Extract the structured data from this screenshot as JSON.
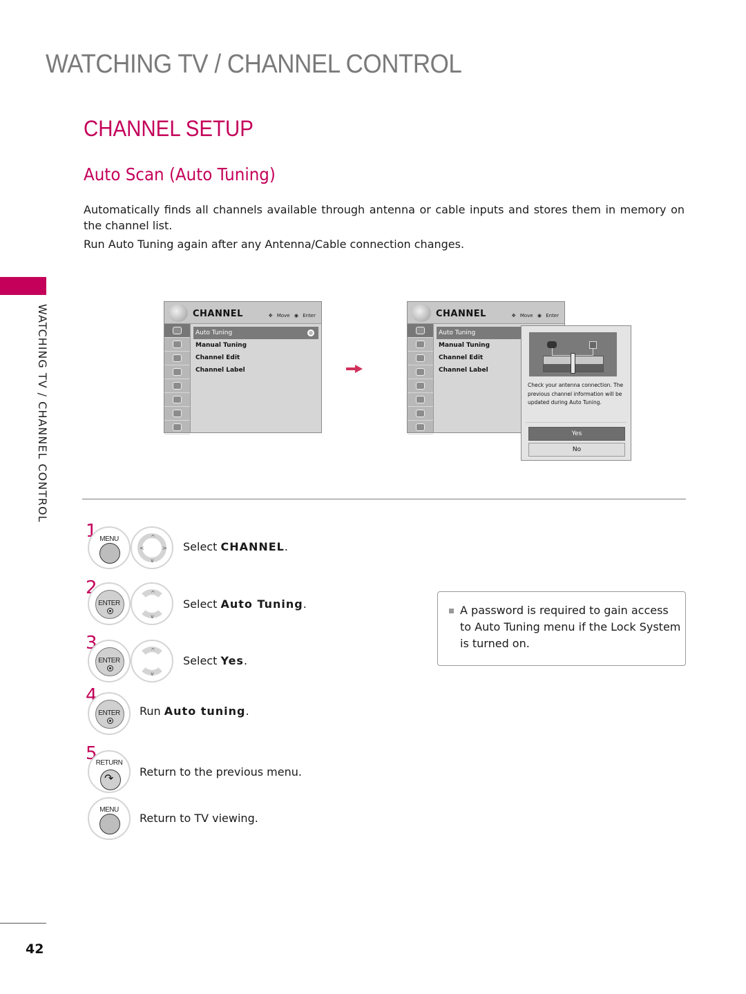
{
  "header": {
    "section_title": "WATCHING TV / CHANNEL CONTROL",
    "page_title": "CHANNEL SETUP",
    "subsection_title": "Auto Scan (Auto Tuning)"
  },
  "description": [
    "Automatically finds all channels available through antenna or cable inputs and stores them in memory on the channel list.",
    "Run Auto Tuning again after any Antenna/Cable connection changes."
  ],
  "side_tab": {
    "label": "WATCHING TV / CHANNEL CONTROL",
    "accent_color": "#c4005a"
  },
  "menu_left": {
    "title": "CHANNEL",
    "hint_move": "Move",
    "hint_enter": "Enter",
    "items": [
      "Auto Tuning",
      "Manual Tuning",
      "Channel Edit",
      "Channel Label"
    ],
    "selected_index": 0,
    "icons": [
      "channel-icon",
      "picture-icon",
      "audio-icon",
      "time-icon",
      "option-icon",
      "lock-icon",
      "input-icon",
      "usb-icon"
    ]
  },
  "menu_right": {
    "title": "CHANNEL",
    "hint_move": "Move",
    "hint_enter": "Enter",
    "items": [
      "Auto Tuning",
      "Manual Tuning",
      "Channel Edit",
      "Channel Label"
    ],
    "selected_index": 0,
    "popup": {
      "message": "Check your antenna connection. The previous channel information will be updated during Auto Tuning.",
      "yes_label": "Yes",
      "no_label": "No",
      "selected": "Yes"
    }
  },
  "steps": [
    {
      "number": "1",
      "buttons": [
        "MENU",
        "navigation-pad"
      ],
      "prefix": "Select ",
      "emphasis": "CHANNEL",
      "suffix": "."
    },
    {
      "number": "2",
      "buttons": [
        "ENTER",
        "up-down"
      ],
      "prefix": "Select ",
      "emphasis": "Auto Tuning",
      "suffix": "."
    },
    {
      "number": "3",
      "buttons": [
        "ENTER",
        "up-down"
      ],
      "prefix": "Select ",
      "emphasis": "Yes",
      "suffix": "."
    },
    {
      "number": "4",
      "buttons": [
        "ENTER"
      ],
      "prefix": "Run ",
      "emphasis": "Auto tuning",
      "suffix": "."
    },
    {
      "number": "5",
      "buttons": [
        "RETURN"
      ],
      "prefix": "Return to the previous menu.",
      "emphasis": "",
      "suffix": ""
    },
    {
      "number": "",
      "buttons": [
        "MENU"
      ],
      "prefix": "Return to TV viewing.",
      "emphasis": "",
      "suffix": ""
    }
  ],
  "button_labels": {
    "menu": "MENU",
    "enter": "ENTER",
    "return": "RETURN"
  },
  "note": "A password is required to gain access to Auto Tuning menu if the Lock System is turned on.",
  "page_number": "42"
}
